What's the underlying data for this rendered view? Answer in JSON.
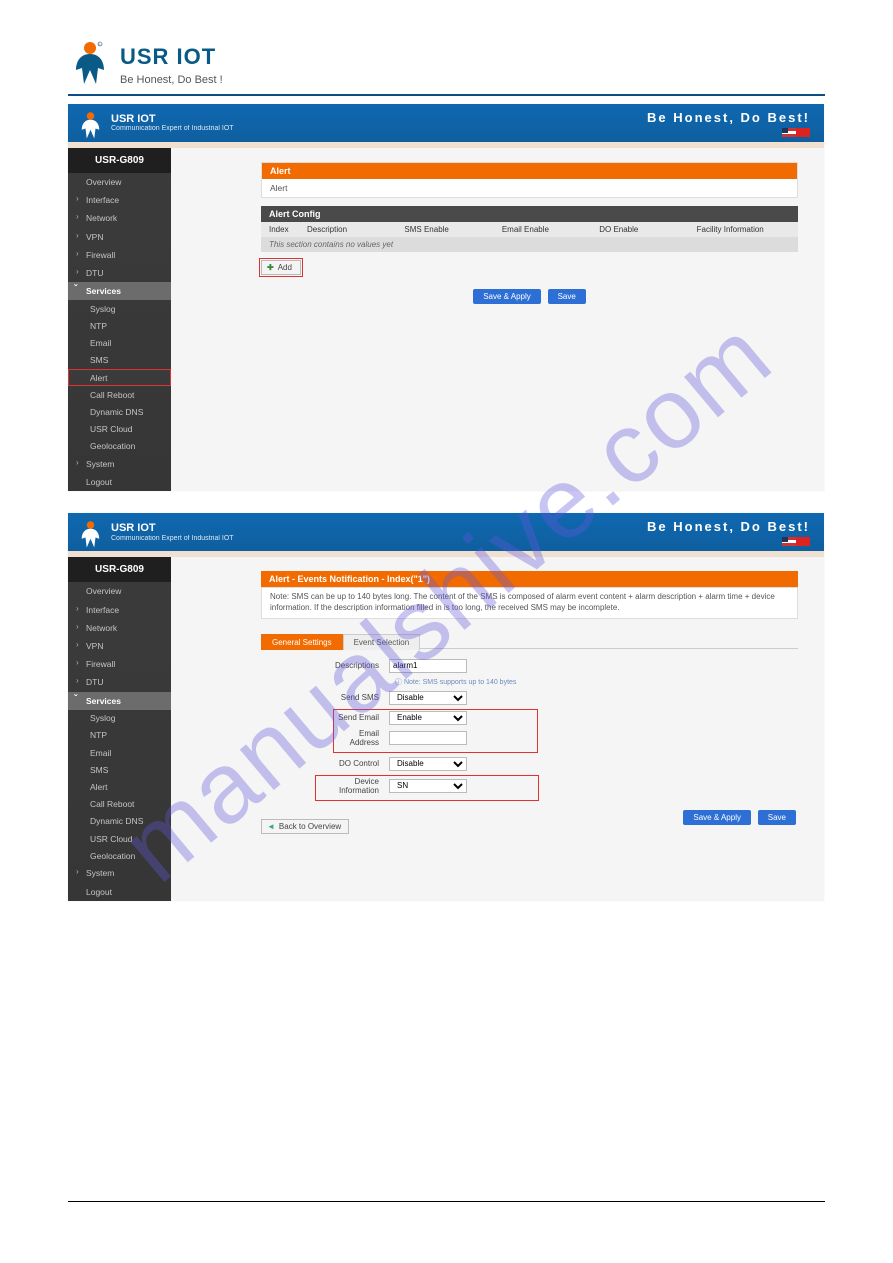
{
  "page": {
    "brand": "USR IOT",
    "slogan": "Be Honest, Do Best !",
    "watermark": "manualshive.com"
  },
  "shared": {
    "banner_brand": "USR IOT",
    "banner_sub": "Communication Expert of Industrial IOT",
    "banner_slogan": "Be Honest, Do Best!",
    "device": "USR-G809",
    "save_apply": "Save & Apply",
    "save": "Save"
  },
  "nav": {
    "overview": "Overview",
    "interface": "Interface",
    "network": "Network",
    "vpn": "VPN",
    "firewall": "Firewall",
    "dtu": "DTU",
    "services": "Services",
    "syslog": "Syslog",
    "ntp": "NTP",
    "email": "Email",
    "sms": "SMS",
    "alert": "Alert",
    "call_reboot": "Call Reboot",
    "dyndns": "Dynamic DNS",
    "usrcloud": "USR Cloud",
    "geolocation": "Geolocation",
    "system": "System",
    "logout": "Logout"
  },
  "shot1": {
    "panel_title": "Alert",
    "panel_desc": "Alert",
    "config_title": "Alert Config",
    "cols": [
      "Index",
      "Description",
      "SMS Enable",
      "Email Enable",
      "DO Enable",
      "Facility Information"
    ],
    "empty_msg": "This section contains no values yet",
    "add_label": "Add"
  },
  "shot2": {
    "panel_title": "Alert - Events Notification - Index(\"1\")",
    "note": "Note: SMS can be up to 140 bytes long. The content of the SMS is composed of alarm event content + alarm description + alarm time + device information. If the description information filled in is too long, the received SMS may be incomplete.",
    "tabs": [
      "General Settings",
      "Event Selection"
    ],
    "form": {
      "descriptions_label": "Descriptions",
      "descriptions_value": "alarm1",
      "descriptions_hint": "Note: SMS supports up to 140 bytes",
      "send_sms_label": "Send SMS",
      "send_sms_value": "Disable",
      "send_email_label": "Send Email",
      "send_email_value": "Enable",
      "email_addr_label": "Email Address",
      "email_addr_value": "",
      "do_control_label": "DO Control",
      "do_control_value": "Disable",
      "device_info_label": "Device Information",
      "device_info_value": "SN"
    },
    "back_label": "Back to Overview"
  }
}
